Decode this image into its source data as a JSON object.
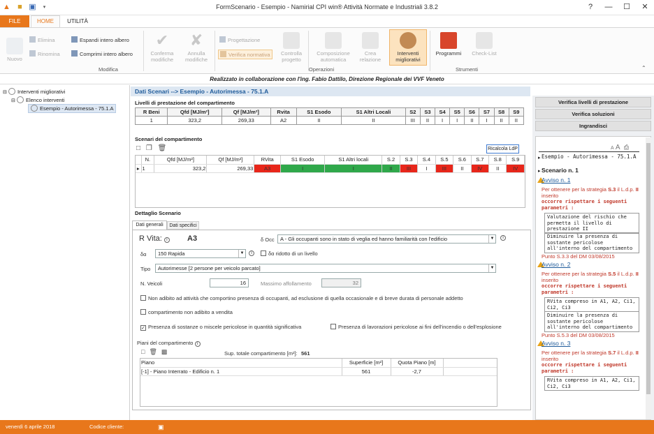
{
  "app": {
    "title": "FormScenario - Esempio - Namirial CPI win® Attività  Normate e Industriali 3.8.2",
    "help": "?",
    "min": "—",
    "max": "☐",
    "close": "✕"
  },
  "tabs": {
    "file": "FILE",
    "home": "HOME",
    "util": "UTILITÀ"
  },
  "ribbon": {
    "nuovo": "Nuovo",
    "elimina": "Elimina",
    "rinomina": "Rinomina",
    "espandi": "Espandi intero albero",
    "comprimi": "Comprimi intero albero",
    "conferma": "Conferma modifiche",
    "annulla": "Annulla modifiche",
    "progettazione": "Progettazione",
    "verifica_norm": "Verifica normativa",
    "controlla": "Controlla progetto",
    "composizione": "Composizione automatica",
    "crea": "Crea relazione",
    "interventi": "Interventi migliorativi",
    "programmi": "Programmi",
    "checklist": "Check-List",
    "group_modifica": "Modifica",
    "group_operazioni": "Operazioni",
    "group_strumenti": "Strumenti"
  },
  "banner": "Realizzato in collaborazione con l'ing. Fabio Dattilo, Direzione Regionale dei VVF Veneto",
  "tree": {
    "root": "Interventi migliorativi",
    "child": "Elenco interventi",
    "leaf": "Esempio - Autorimessa - 75.1.A"
  },
  "main": {
    "header": "Dati Scenari --> Esempio - Autorimessa - 75.1.A",
    "livelli_title": "Livelli di prestazione del compartimento",
    "livelli_headers": [
      "R Beni",
      "Qfd  [MJ/m²]",
      "Qf  [MJ/m²]",
      "Rvita",
      "S1 Esodo",
      "S1 Altri Locali",
      "S2",
      "S3",
      "S4",
      "S5",
      "S6",
      "S7",
      "S8",
      "S9"
    ],
    "livelli_row": [
      "1",
      "323,2",
      "269,33",
      "A2",
      "II",
      "II",
      "III",
      "II",
      "I",
      "I",
      "II",
      "I",
      "II",
      "II"
    ],
    "scenari_title": "Scenari del compartimento",
    "ricalcola": "Ricalcola LdP",
    "scen_headers": [
      "N.",
      "Qfd  [MJ/m²]",
      "Qf  [MJ/m²]",
      "RVita",
      "S1 Esodo",
      "S1 Altri locali",
      "S.2",
      "S.3",
      "S.4",
      "S.5",
      "S.6",
      "S.7",
      "S.8",
      "S.9"
    ],
    "scen_row": [
      "1",
      "323,2",
      "269,33",
      "A3",
      "I",
      "I",
      "II",
      "III",
      "I",
      "III",
      "II",
      "IV",
      "II",
      "IV"
    ],
    "dettaglio_title": "Dettaglio Scenario",
    "subtab1": "Dati generali",
    "subtab2": "Dati specifici",
    "rvita_label": "R Vita:",
    "rvita_value": "A3",
    "docc_label": "δ Occ",
    "docc_value": "A - Gli occupanti sono in stato di veglia ed hanno familiarità con l'edificio",
    "da_label": "δα",
    "da_value": "150 Rapida",
    "da_ridotto": "δα  ridotto di un livello",
    "tipo_label": "Tipo",
    "tipo_value": "Autorimesse [2 persone per veicolo parcato]",
    "nveicoli_label": "N. Veicoli",
    "nveicoli_value": "16",
    "massimo_label": "Massimo affollamento",
    "massimo_value": "32",
    "cb1": "Non adibito ad attività che comportino presenza di occupanti, ad esclusione di quella occasionale e di breve durata di personale addetto",
    "cb2": "compartimento non adibito a vendita",
    "cb3": "Presenza di sostanze o miscele pericolose in quantità significativa",
    "cb4": "Presenza di lavorazioni pericolose ai fini dell'incendio o dell'esplosione",
    "piani_title": "Piani del compartimento",
    "sup_label": "Sup. totale compartimento [m²]:",
    "sup_value": "561",
    "piani_headers": [
      "Piano",
      "Superficie [m²]",
      "Quota Piano [m]"
    ],
    "piani_row": [
      "[-1] - Piano Interrato - Edificio n. 1",
      "561",
      "-2,7"
    ]
  },
  "right": {
    "btn1": "Verifica livelli di prestazione",
    "btn2": "Verifica soluzioni",
    "btn3": "Ingrandisci",
    "font_small": "A",
    "font_big": "A",
    "title": "Esempio - Autorimessa - 75.1.A",
    "scen": "Scenario n. 1",
    "avvisi": [
      {
        "t": "Avviso n. 1",
        "p1": "Per ottenere per la strategia ",
        "s": "S.3",
        "p2": " il L.d.p. ",
        "l": "II",
        "p3": " inserito",
        "occ": "occorre rispettare i seguenti parametri :",
        "b1": "Valutazione del rischio che permetta il livello di prestazione II",
        "b2": "Diminuire la presenza di sostante pericolose all'interno del compartimento",
        "punto": "Punto S.3.3 del DM 03/08/2015"
      },
      {
        "t": "Avviso n. 2",
        "p1": "Per ottenere per la strategia ",
        "s": "S.5",
        "p2": " il L.d.p. ",
        "l": "II",
        "p3": " inserito",
        "occ": "occorre rispettare i seguenti parametri :",
        "b1": "RVita compreso in A1, A2, Ci1, Ci2, Ci3",
        "b2": "Diminuire la presenza di sostante pericolose all'interno del compartimento",
        "punto": "Punto S.5.3 del DM 03/08/2015"
      },
      {
        "t": "Avviso n. 3",
        "p1": "Per ottenere per la strategia ",
        "s": "S.7",
        "p2": " il L.d.p. ",
        "l": "II",
        "p3": " inserito",
        "occ": "occorre rispettare i seguenti parametri :",
        "b1": "RVita compreso in A1, A2, Ci1, Ci2, Ci3"
      }
    ]
  },
  "status": {
    "date": "venerdì 6 aprile 2018",
    "codice": "Codice cliente:"
  }
}
